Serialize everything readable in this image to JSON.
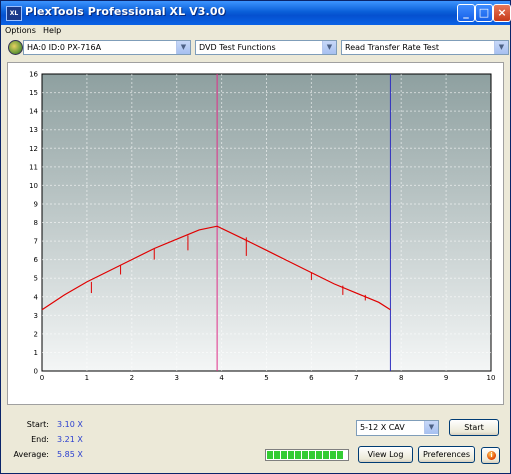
{
  "window": {
    "title": "PlexTools Professional XL V3.00",
    "app_icon_text": "XL"
  },
  "menu": [
    "Options",
    "Help"
  ],
  "toolbar": {
    "drive": "HA:0 ID:0  PX-716A",
    "function": "DVD Test Functions",
    "test": "Read Transfer Rate Test"
  },
  "chart_data": {
    "type": "line",
    "xlim": [
      0,
      10
    ],
    "ylim": [
      0,
      16
    ],
    "x_ticks": [
      "0",
      "1",
      "2",
      "3",
      "4",
      "5",
      "6",
      "7",
      "8",
      "9",
      "10"
    ],
    "y_ticks": [
      "0",
      "1",
      "2",
      "3",
      "4",
      "5",
      "6",
      "7",
      "8",
      "9",
      "10",
      "11",
      "12",
      "13",
      "14",
      "15",
      "16"
    ],
    "grid": true,
    "background": "gradient-gray",
    "line_color": "#e00000",
    "markers": [
      {
        "x": 3.9,
        "color": "#e0308a"
      },
      {
        "x": 7.76,
        "color": "#3030c0"
      }
    ],
    "series": [
      {
        "x": [
          0,
          0.5,
          1,
          1.5,
          2,
          2.5,
          3,
          3.5,
          3.9,
          4.5,
          5,
          5.5,
          6,
          6.5,
          7,
          7.5,
          7.76
        ],
        "y": [
          3.3,
          4.1,
          4.8,
          5.4,
          6.0,
          6.6,
          7.1,
          7.6,
          7.8,
          7.1,
          6.5,
          5.9,
          5.3,
          4.7,
          4.2,
          3.7,
          3.3
        ]
      }
    ],
    "dips": [
      {
        "x": 1.1,
        "y": 4.8,
        "depth": 0.6
      },
      {
        "x": 1.75,
        "y": 5.7,
        "depth": 0.5
      },
      {
        "x": 2.5,
        "y": 6.6,
        "depth": 0.6
      },
      {
        "x": 3.25,
        "y": 7.3,
        "depth": 0.8
      },
      {
        "x": 4.55,
        "y": 7.2,
        "depth": 1.0
      },
      {
        "x": 6.0,
        "y": 5.3,
        "depth": 0.4
      },
      {
        "x": 6.7,
        "y": 4.6,
        "depth": 0.5
      },
      {
        "x": 7.2,
        "y": 4.1,
        "depth": 0.3
      }
    ]
  },
  "stats": {
    "start_label": "Start:",
    "start_value": "3.10 X",
    "end_label": "End:",
    "end_value": "3.21 X",
    "average_label": "Average:",
    "average_value": "5.85 X"
  },
  "speed_select": "5-12 X CAV",
  "buttons": {
    "start": "Start",
    "view_log": "View Log",
    "preferences": "Preferences"
  },
  "progress": {
    "fraction": 1.0
  }
}
